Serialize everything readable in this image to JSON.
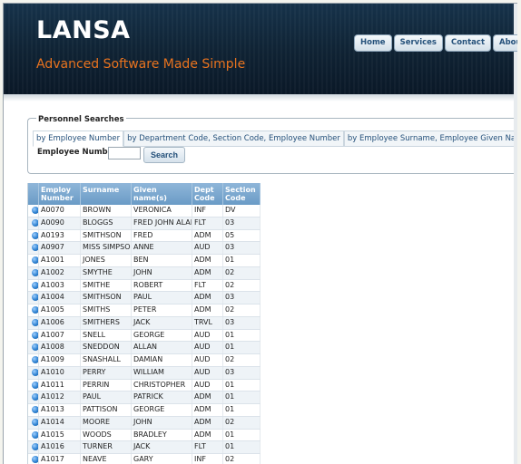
{
  "header": {
    "logo": "LANSA",
    "tagline": "Advanced Software Made Simple",
    "nav": [
      "Home",
      "Services",
      "Contact",
      "About"
    ]
  },
  "search": {
    "legend": "Personnel Searches",
    "tabs": [
      "by Employee Number",
      "by Department Code, Section Code, Employee Number",
      "by Employee Surname, Employee Given Name(s)"
    ],
    "label": "Employee Number",
    "input_value": "",
    "button": "Search"
  },
  "grid": {
    "headers": [
      "Employ Number",
      "Surname",
      "Given name(s)",
      "Dept Code",
      "Section Code"
    ],
    "rows": [
      [
        "A0070",
        "BROWN",
        "VERONICA",
        "INF",
        "DV"
      ],
      [
        "A0090",
        "BLOGGS",
        "FRED JOHN ALAN",
        "FLT",
        "03"
      ],
      [
        "A0193",
        "SMITHSON",
        "FRED",
        "ADM",
        "05"
      ],
      [
        "A0907",
        "MISS SIMPSON",
        "ANNE",
        "AUD",
        "03"
      ],
      [
        "A1001",
        "JONES",
        "BEN",
        "ADM",
        "01"
      ],
      [
        "A1002",
        "SMYTHE",
        "JOHN",
        "ADM",
        "02"
      ],
      [
        "A1003",
        "SMITHE",
        "ROBERT",
        "FLT",
        "02"
      ],
      [
        "A1004",
        "SMITHSON",
        "PAUL",
        "ADM",
        "03"
      ],
      [
        "A1005",
        "SMITHS",
        "PETER",
        "ADM",
        "02"
      ],
      [
        "A1006",
        "SMITHERS",
        "JACK",
        "TRVL",
        "03"
      ],
      [
        "A1007",
        "SNELL",
        "GEORGE",
        "AUD",
        "01"
      ],
      [
        "A1008",
        "SNEDDON",
        "ALLAN",
        "AUD",
        "01"
      ],
      [
        "A1009",
        "SNASHALL",
        "DAMIAN",
        "AUD",
        "02"
      ],
      [
        "A1010",
        "PERRY",
        "WILLIAM",
        "AUD",
        "03"
      ],
      [
        "A1011",
        "PERRIN",
        "CHRISTOPHER",
        "AUD",
        "01"
      ],
      [
        "A1012",
        "PAUL",
        "PATRICK",
        "ADM",
        "01"
      ],
      [
        "A1013",
        "PATTISON",
        "GEORGE",
        "ADM",
        "01"
      ],
      [
        "A1014",
        "MOORE",
        "JOHN",
        "ADM",
        "02"
      ],
      [
        "A1015",
        "WOODS",
        "BRADLEY",
        "ADM",
        "01"
      ],
      [
        "A1016",
        "TURNER",
        "JACK",
        "FLT",
        "01"
      ],
      [
        "A1017",
        "NEAVE",
        "GARY",
        "INF",
        "02"
      ]
    ]
  },
  "colors": {
    "accent": "#e8731f",
    "header_bg": "#0f2233",
    "grid_header": "#6a9bc6"
  }
}
